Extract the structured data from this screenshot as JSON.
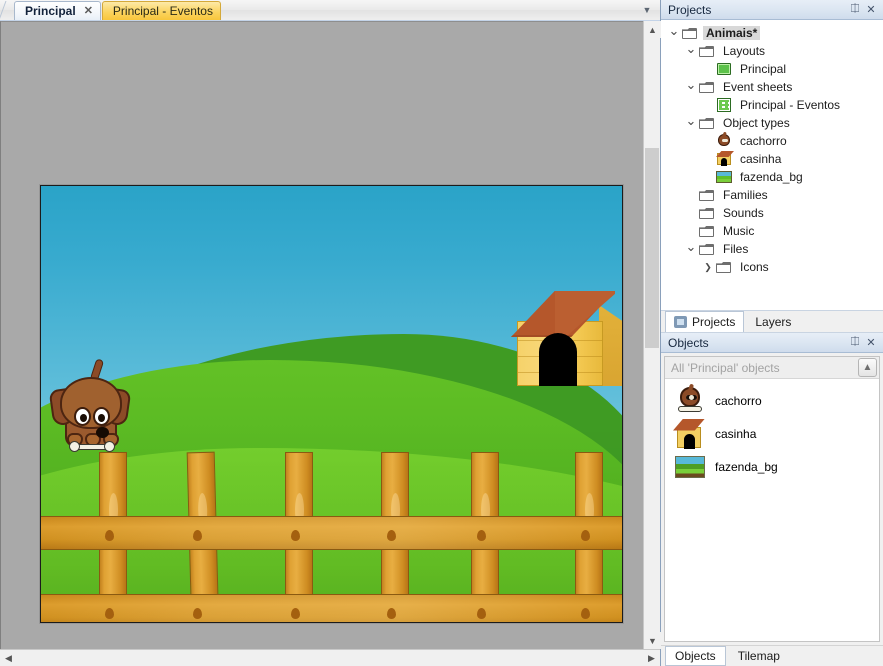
{
  "window": {
    "document_tabs": [
      {
        "label": "Principal",
        "active": true,
        "closable": true
      },
      {
        "label": "Principal - Eventos",
        "active": false,
        "closable": false
      }
    ],
    "tablist_dropdown_icon": "chevron-down-icon"
  },
  "projects_panel": {
    "title": "Projects",
    "pin_icon": "pin-icon",
    "close_icon": "close-icon",
    "tree": [
      {
        "label": "Animais*",
        "indent": 0,
        "twisty": "expanded",
        "icon": "folder-icon",
        "selected": true
      },
      {
        "label": "Layouts",
        "indent": 1,
        "twisty": "expanded",
        "icon": "folder-icon",
        "selected": false
      },
      {
        "label": "Principal",
        "indent": 2,
        "twisty": "none",
        "icon": "layout-icon",
        "selected": false
      },
      {
        "label": "Event sheets",
        "indent": 1,
        "twisty": "expanded",
        "icon": "folder-icon",
        "selected": false
      },
      {
        "label": "Principal - Eventos",
        "indent": 2,
        "twisty": "none",
        "icon": "event-sheet-icon",
        "selected": false
      },
      {
        "label": "Object types",
        "indent": 1,
        "twisty": "expanded",
        "icon": "folder-icon",
        "selected": false
      },
      {
        "label": "cachorro",
        "indent": 2,
        "twisty": "none",
        "icon": "dog-object-icon",
        "selected": false
      },
      {
        "label": "casinha",
        "indent": 2,
        "twisty": "none",
        "icon": "doghouse-object-icon",
        "selected": false
      },
      {
        "label": "fazenda_bg",
        "indent": 2,
        "twisty": "none",
        "icon": "background-object-icon",
        "selected": false
      },
      {
        "label": "Families",
        "indent": 1,
        "twisty": "none",
        "icon": "folder-icon",
        "selected": false
      },
      {
        "label": "Sounds",
        "indent": 1,
        "twisty": "none",
        "icon": "folder-icon",
        "selected": false
      },
      {
        "label": "Music",
        "indent": 1,
        "twisty": "none",
        "icon": "folder-icon",
        "selected": false
      },
      {
        "label": "Files",
        "indent": 1,
        "twisty": "expanded",
        "icon": "folder-icon",
        "selected": false
      },
      {
        "label": "Icons",
        "indent": 2,
        "twisty": "collapsed",
        "icon": "folder-icon",
        "selected": false
      }
    ]
  },
  "dock_tabs": [
    {
      "label": "Projects",
      "active": true,
      "icon": "projects-icon"
    },
    {
      "label": "Layers",
      "active": false,
      "icon": ""
    }
  ],
  "objects_panel": {
    "title": "Objects",
    "pin_icon": "pin-icon",
    "close_icon": "close-icon",
    "filter_placeholder": "All 'Principal' objects",
    "filter_value": "",
    "up_button_icon": "up-arrow-icon",
    "items": [
      {
        "label": "cachorro",
        "icon": "dog-object-icon"
      },
      {
        "label": "casinha",
        "icon": "doghouse-object-icon"
      },
      {
        "label": "fazenda_bg",
        "icon": "background-object-icon"
      }
    ]
  },
  "bottom_tabs": [
    {
      "label": "Objects",
      "active": true
    },
    {
      "label": "Tilemap",
      "active": false
    }
  ],
  "scrollbars": {
    "v_up_icon": "chevron-up-icon",
    "v_down_icon": "chevron-down-icon",
    "h_left_icon": "chevron-left-icon",
    "h_right_icon": "chevron-right-icon"
  },
  "layout_canvas": {
    "name": "Principal",
    "objects": [
      {
        "name": "fazenda_bg",
        "type": "background"
      },
      {
        "name": "cachorro",
        "type": "sprite"
      },
      {
        "name": "casinha",
        "type": "sprite"
      }
    ]
  },
  "colors": {
    "tab_active_bg": "#ffffff",
    "tab_inactive_bg": "#f8c63c",
    "panel_title_bg": "#dce6f2",
    "canvas_backdrop": "#a9a9a9",
    "sky_top": "#2aa3c8",
    "sky_bottom": "#a9dcea",
    "grass_light": "#74cf2d",
    "grass_dark": "#3f9b23",
    "fence_wood": "#dc9c2c",
    "house_body": "#f3cf63",
    "house_roof": "#b5572b",
    "dog_fur": "#9b5a2e"
  }
}
